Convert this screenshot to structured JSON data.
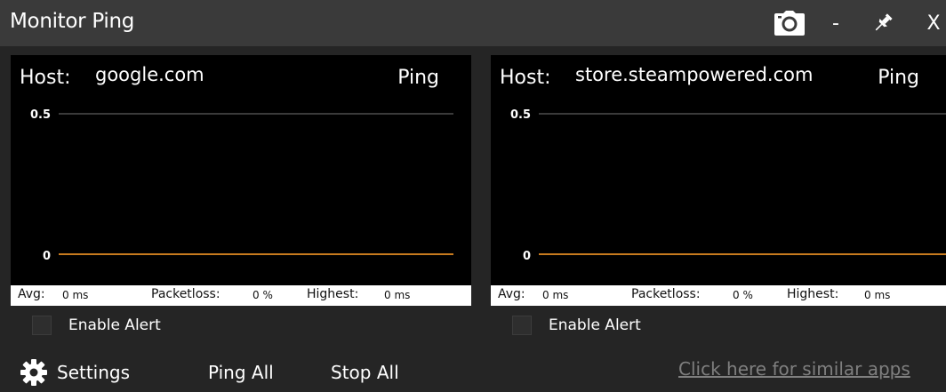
{
  "window": {
    "title": "Monitor Ping",
    "controls": {
      "minimize": "-",
      "close": "X"
    }
  },
  "monitors": [
    {
      "host_label": "Host:",
      "host": "google.com",
      "ping_label": "Ping",
      "y_ticks": [
        "0.5",
        "0"
      ],
      "avg_label": "Avg:",
      "avg_value": "0 ms",
      "packetloss_label": "Packetloss:",
      "packetloss_value": "0 %",
      "highest_label": "Highest:",
      "highest_value": "0 ms",
      "alert_label": "Enable Alert",
      "alert_enabled": false
    },
    {
      "host_label": "Host:",
      "host": "store.steampowered.com",
      "ping_label": "Ping",
      "y_ticks": [
        "0.5",
        "0"
      ],
      "avg_label": "Avg:",
      "avg_value": "0 ms",
      "packetloss_label": "Packetloss:",
      "packetloss_value": "0 %",
      "highest_label": "Highest:",
      "highest_value": "0 ms",
      "alert_label": "Enable Alert",
      "alert_enabled": false
    }
  ],
  "footer": {
    "settings_label": "Settings",
    "ping_all_label": "Ping All",
    "stop_all_label": "Stop All",
    "similar_apps_link": "Click here for similar apps"
  },
  "colors": {
    "titlebar": "#3a3a3a",
    "background": "#252525",
    "graph_background": "#000000",
    "gridline": "#3a3a3a",
    "ping_line": "#c77a1e",
    "link": "#7f7f7f"
  },
  "icons": [
    "camera-icon",
    "pin-icon",
    "gear-icon"
  ]
}
